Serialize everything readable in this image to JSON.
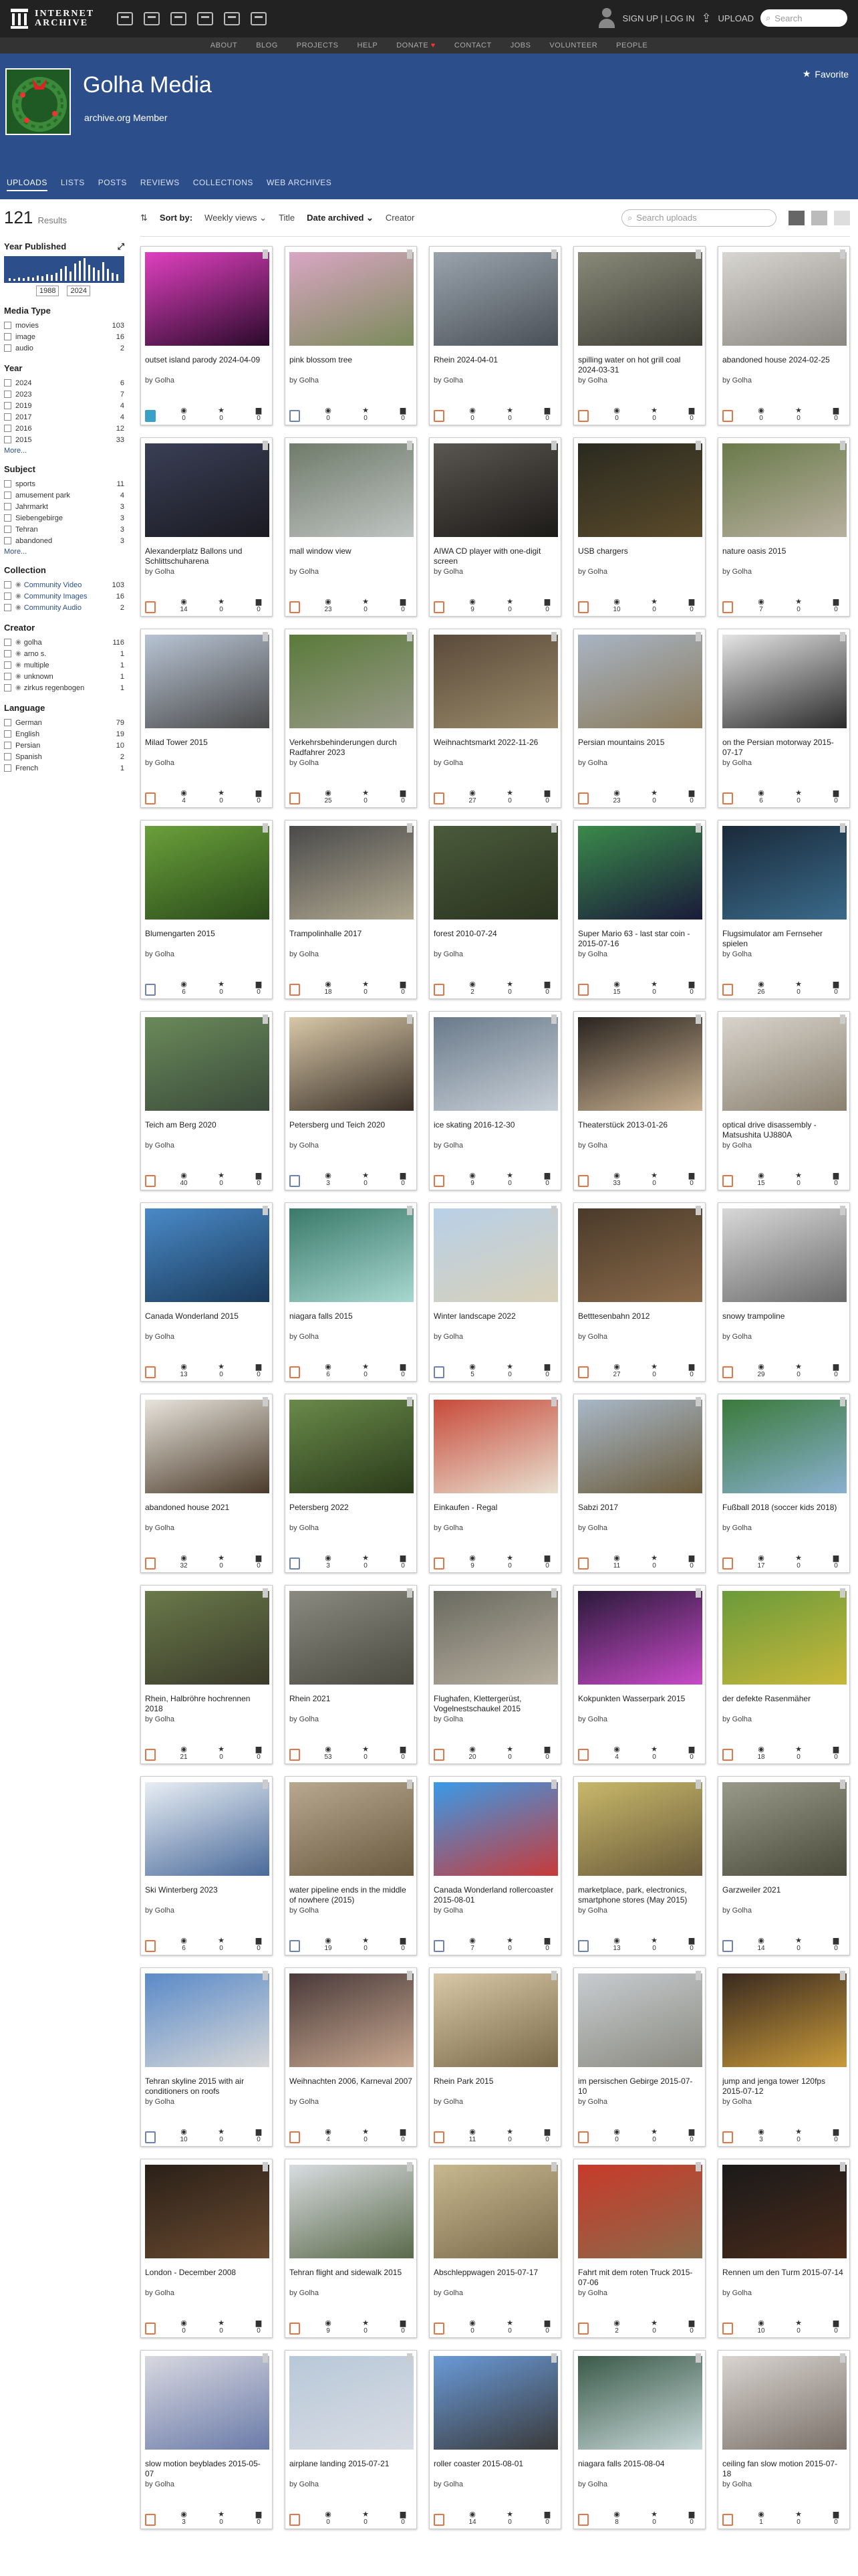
{
  "topbar": {
    "logo_line1": "INTERNET",
    "logo_line2": "ARCHIVE",
    "auth": "SIGN UP | LOG IN",
    "upload": "UPLOAD",
    "search_placeholder": "Search"
  },
  "subnav": [
    "ABOUT",
    "BLOG",
    "PROJECTS",
    "HELP",
    "DONATE",
    "CONTACT",
    "JOBS",
    "VOLUNTEER",
    "PEOPLE"
  ],
  "profile": {
    "name": "Golha Media",
    "subtitle": "archive.org Member",
    "favorite": "Favorite",
    "tabs": [
      "UPLOADS",
      "LISTS",
      "POSTS",
      "REVIEWS",
      "COLLECTIONS",
      "WEB ARCHIVES"
    ]
  },
  "results": {
    "count": "121",
    "label": "Results"
  },
  "sidebar": {
    "year_published": "Year Published",
    "year_from": "1988",
    "year_to": "2024",
    "media_type": {
      "title": "Media Type",
      "items": [
        {
          "label": "movies",
          "n": "103"
        },
        {
          "label": "image",
          "n": "16"
        },
        {
          "label": "audio",
          "n": "2"
        }
      ]
    },
    "year": {
      "title": "Year",
      "items": [
        {
          "label": "2024",
          "n": "6"
        },
        {
          "label": "2023",
          "n": "7"
        },
        {
          "label": "2019",
          "n": "4"
        },
        {
          "label": "2017",
          "n": "4"
        },
        {
          "label": "2016",
          "n": "12"
        },
        {
          "label": "2015",
          "n": "33"
        }
      ],
      "more": "More..."
    },
    "subject": {
      "title": "Subject",
      "items": [
        {
          "label": "sports",
          "n": "11"
        },
        {
          "label": "amusement park",
          "n": "4"
        },
        {
          "label": "Jahrmarkt",
          "n": "3"
        },
        {
          "label": "Siebengebirge",
          "n": "3"
        },
        {
          "label": "Tehran",
          "n": "3"
        },
        {
          "label": "abandoned",
          "n": "3"
        }
      ],
      "more": "More..."
    },
    "collection": {
      "title": "Collection",
      "items": [
        {
          "label": "Community Video",
          "n": "103"
        },
        {
          "label": "Community Images",
          "n": "16"
        },
        {
          "label": "Community Audio",
          "n": "2"
        }
      ]
    },
    "creator": {
      "title": "Creator",
      "items": [
        {
          "label": "golha",
          "n": "116"
        },
        {
          "label": "arno s.",
          "n": "1"
        },
        {
          "label": "multiple",
          "n": "1"
        },
        {
          "label": "unknown",
          "n": "1"
        },
        {
          "label": "zirkus regenbogen",
          "n": "1"
        }
      ]
    },
    "language": {
      "title": "Language",
      "items": [
        {
          "label": "German",
          "n": "79"
        },
        {
          "label": "English",
          "n": "19"
        },
        {
          "label": "Persian",
          "n": "10"
        },
        {
          "label": "Spanish",
          "n": "2"
        },
        {
          "label": "French",
          "n": "1"
        }
      ]
    }
  },
  "sortbar": {
    "sort_by": "Sort by:",
    "views": "Weekly views",
    "title": "Title",
    "date": "Date archived",
    "creator": "Creator",
    "search_placeholder": "Search uploads"
  },
  "cards": [
    {
      "title": "outset island parody 2024-04-09",
      "by": "by Golha",
      "type": "audio",
      "views": "0",
      "favs": "0",
      "reviews": "0",
      "c1": "#e040c0",
      "c2": "#2a0a2a"
    },
    {
      "title": "pink blossom tree",
      "by": "by Golha",
      "type": "image",
      "views": "0",
      "favs": "0",
      "reviews": "0",
      "c1": "#d9a6c3",
      "c2": "#7a8a5a"
    },
    {
      "title": "Rhein 2024-04-01",
      "by": "by Golha",
      "type": "movies",
      "views": "0",
      "favs": "0",
      "reviews": "0",
      "c1": "#9aa4ad",
      "c2": "#4a5058"
    },
    {
      "title": "spilling water on hot grill coal 2024-03-31",
      "by": "by Golha",
      "type": "movies",
      "views": "0",
      "favs": "0",
      "reviews": "0",
      "c1": "#8a8a7a",
      "c2": "#3c3c34"
    },
    {
      "title": "abandoned house 2024-02-25",
      "by": "by Golha",
      "type": "movies",
      "views": "0",
      "favs": "0",
      "reviews": "0",
      "c1": "#d8d6d2",
      "c2": "#8a8680"
    },
    {
      "title": "Alexanderplatz Ballons und Schlittschuharena",
      "by": "by Golha",
      "type": "movies",
      "views": "14",
      "favs": "0",
      "reviews": "0",
      "c1": "#3a3f55",
      "c2": "#1a1a22"
    },
    {
      "title": "mall window view",
      "by": "by Golha",
      "type": "movies",
      "views": "23",
      "favs": "0",
      "reviews": "0",
      "c1": "#6f7b6a",
      "c2": "#bfc4c2"
    },
    {
      "title": "AIWA CD player with one-digit screen",
      "by": "by Golha",
      "type": "movies",
      "views": "9",
      "favs": "0",
      "reviews": "0",
      "c1": "#5a5650",
      "c2": "#1c1a18"
    },
    {
      "title": "USB chargers",
      "by": "by Golha",
      "type": "movies",
      "views": "10",
      "favs": "0",
      "reviews": "0",
      "c1": "#2a2a20",
      "c2": "#5a4a2a"
    },
    {
      "title": "nature oasis 2015",
      "by": "by Golha",
      "type": "movies",
      "views": "7",
      "favs": "0",
      "reviews": "0",
      "c1": "#6a7a4a",
      "c2": "#b8b0a0"
    },
    {
      "title": "Milad Tower 2015",
      "by": "by Golha",
      "type": "movies",
      "views": "4",
      "favs": "0",
      "reviews": "0",
      "c1": "#b8c4d4",
      "c2": "#4a4a4a"
    },
    {
      "title": "Verkehrsbehinderungen durch Radfahrer 2023",
      "by": "by Golha",
      "type": "movies",
      "views": "25",
      "favs": "0",
      "reviews": "0",
      "c1": "#5a7a3a",
      "c2": "#9a9a8a"
    },
    {
      "title": "Weihnachtsmarkt 2022-11-26",
      "by": "by Golha",
      "type": "movies",
      "views": "27",
      "favs": "0",
      "reviews": "0",
      "c1": "#5a4a3a",
      "c2": "#9a8a6a"
    },
    {
      "title": "Persian mountains 2015",
      "by": "by Golha",
      "type": "movies",
      "views": "23",
      "favs": "0",
      "reviews": "0",
      "c1": "#a8b4c4",
      "c2": "#8a7a5a"
    },
    {
      "title": "on the Persian motorway 2015-07-17",
      "by": "by Golha",
      "type": "movies",
      "views": "6",
      "favs": "0",
      "reviews": "0",
      "c1": "#e4e4e4",
      "c2": "#2a2a2a"
    },
    {
      "title": "Blumengarten 2015",
      "by": "by Golha",
      "type": "image",
      "views": "6",
      "favs": "0",
      "reviews": "0",
      "c1": "#6aa03a",
      "c2": "#2a4a1a"
    },
    {
      "title": "Trampolinhalle 2017",
      "by": "by Golha",
      "type": "movies",
      "views": "18",
      "favs": "0",
      "reviews": "0",
      "c1": "#4a4a4a",
      "c2": "#b0a890"
    },
    {
      "title": "forest 2010-07-24",
      "by": "by Golha",
      "type": "movies",
      "views": "2",
      "favs": "0",
      "reviews": "0",
      "c1": "#4a5a3a",
      "c2": "#2a3320"
    },
    {
      "title": "Super Mario 63 - last star coin - 2015-07-16",
      "by": "by Golha",
      "type": "movies",
      "views": "15",
      "favs": "0",
      "reviews": "0",
      "c1": "#3a8a4a",
      "c2": "#1a1a3a"
    },
    {
      "title": "Flugsimulator am Fernseher spielen",
      "by": "by Golha",
      "type": "movies",
      "views": "26",
      "favs": "0",
      "reviews": "0",
      "c1": "#1a2a3a",
      "c2": "#3a6a8a"
    },
    {
      "title": "Teich am Berg 2020",
      "by": "by Golha",
      "type": "movies",
      "views": "40",
      "favs": "0",
      "reviews": "0",
      "c1": "#6a8a5a",
      "c2": "#3a4a3a"
    },
    {
      "title": "Petersberg und Teich 2020",
      "by": "by Golha",
      "type": "image",
      "views": "3",
      "favs": "0",
      "reviews": "0",
      "c1": "#d8c8a8",
      "c2": "#3a3028"
    },
    {
      "title": "ice skating 2016-12-30",
      "by": "by Golha",
      "type": "movies",
      "views": "9",
      "favs": "0",
      "reviews": "0",
      "c1": "#6a7a8a",
      "c2": "#c8d0d8"
    },
    {
      "title": "Theaterstück 2013-01-26",
      "by": "by Golha",
      "type": "movies",
      "views": "33",
      "favs": "0",
      "reviews": "0",
      "c1": "#2a2420",
      "c2": "#c8b090"
    },
    {
      "title": "optical drive disassembly - Matsushita UJ880A",
      "by": "by Golha",
      "type": "movies",
      "views": "15",
      "favs": "0",
      "reviews": "0",
      "c1": "#d8d4cc",
      "c2": "#8a8070"
    },
    {
      "title": "Canada Wonderland 2015",
      "by": "by Golha",
      "type": "movies",
      "views": "13",
      "favs": "0",
      "reviews": "0",
      "c1": "#4a8ac8",
      "c2": "#1a3a5a"
    },
    {
      "title": "niagara falls 2015",
      "by": "by Golha",
      "type": "movies",
      "views": "6",
      "favs": "0",
      "reviews": "0",
      "c1": "#3a7a6a",
      "c2": "#a8d8d0"
    },
    {
      "title": "Winter landscape 2022",
      "by": "by Golha",
      "type": "image",
      "views": "5",
      "favs": "0",
      "reviews": "0",
      "c1": "#b8d0e8",
      "c2": "#d8d0b8"
    },
    {
      "title": "Betttesenbahn 2012",
      "by": "by Golha",
      "type": "movies",
      "views": "27",
      "favs": "0",
      "reviews": "0",
      "c1": "#4a3a2a",
      "c2": "#8a6a4a"
    },
    {
      "title": "snowy trampoline",
      "by": "by Golha",
      "type": "movies",
      "views": "29",
      "favs": "0",
      "reviews": "0",
      "c1": "#d8d8d8",
      "c2": "#6a6a6a"
    },
    {
      "title": "abandoned house 2021",
      "by": "by Golha",
      "type": "movies",
      "views": "32",
      "favs": "0",
      "reviews": "0",
      "c1": "#e8e4dc",
      "c2": "#4a3a2a"
    },
    {
      "title": "Petersberg 2022",
      "by": "by Golha",
      "type": "image",
      "views": "3",
      "favs": "0",
      "reviews": "0",
      "c1": "#6a8a4a",
      "c2": "#2a3a1a"
    },
    {
      "title": "Einkaufen - Regal",
      "by": "by Golha",
      "type": "movies",
      "views": "9",
      "favs": "0",
      "reviews": "0",
      "c1": "#c84a3a",
      "c2": "#e8e0d0"
    },
    {
      "title": "Sabzi 2017",
      "by": "by Golha",
      "type": "movies",
      "views": "11",
      "favs": "0",
      "reviews": "0",
      "c1": "#a8b8c8",
      "c2": "#6a5a3a"
    },
    {
      "title": "Fußball 2018 (soccer kids 2018)",
      "by": "by Golha",
      "type": "movies",
      "views": "17",
      "favs": "0",
      "reviews": "0",
      "c1": "#3a7a3a",
      "c2": "#8ab0d0"
    },
    {
      "title": "Rhein, Halbröhre hochrennen 2018",
      "by": "by Golha",
      "type": "movies",
      "views": "21",
      "favs": "0",
      "reviews": "0",
      "c1": "#6a7a4a",
      "c2": "#3a3a2a"
    },
    {
      "title": "Rhein 2021",
      "by": "by Golha",
      "type": "movies",
      "views": "53",
      "favs": "0",
      "reviews": "0",
      "c1": "#8a8a80",
      "c2": "#4a4a40"
    },
    {
      "title": "Flughafen, Klettergerüst, Vogelnestschaukel 2015",
      "by": "by Golha",
      "type": "movies",
      "views": "20",
      "favs": "0",
      "reviews": "0",
      "c1": "#6a6a60",
      "c2": "#b8b0a0"
    },
    {
      "title": "Kokpunkten Wasserpark 2015",
      "by": "by Golha",
      "type": "movies",
      "views": "4",
      "favs": "0",
      "reviews": "0",
      "c1": "#2a1a3a",
      "c2": "#c84ac8"
    },
    {
      "title": "der defekte Rasenmäher",
      "by": "by Golha",
      "type": "movies",
      "views": "18",
      "favs": "0",
      "reviews": "0",
      "c1": "#6a9a3a",
      "c2": "#c8b83a"
    },
    {
      "title": "Ski Winterberg 2023",
      "by": "by Golha",
      "type": "movies",
      "views": "6",
      "favs": "0",
      "reviews": "0",
      "c1": "#e8eef4",
      "c2": "#4a6a9a"
    },
    {
      "title": "water pipeline ends in the middle of nowhere (2015)",
      "by": "by Golha",
      "type": "image",
      "views": "19",
      "favs": "0",
      "reviews": "0",
      "c1": "#b8a890",
      "c2": "#6a5a40"
    },
    {
      "title": "Canada Wonderland rollercoaster 2015-08-01",
      "by": "by Golha",
      "type": "image",
      "views": "7",
      "favs": "0",
      "reviews": "0",
      "c1": "#3a9ae8",
      "c2": "#c83a3a"
    },
    {
      "title": "marketplace, park, electronics, smartphone stores (May 2015)",
      "by": "by Golha",
      "type": "image",
      "views": "13",
      "favs": "0",
      "reviews": "0",
      "c1": "#c8b86a",
      "c2": "#6a5a3a"
    },
    {
      "title": "Garzweiler 2021",
      "by": "by Golha",
      "type": "image",
      "views": "14",
      "favs": "0",
      "reviews": "0",
      "c1": "#9a9a8a",
      "c2": "#4a4a3a"
    },
    {
      "title": "Tehran skyline 2015 with air conditioners on roofs",
      "by": "by Golha",
      "type": "image",
      "views": "10",
      "favs": "0",
      "reviews": "0",
      "c1": "#5a8ac8",
      "c2": "#d8d8d8"
    },
    {
      "title": "Weihnachten 2006, Karneval 2007",
      "by": "by Golha",
      "type": "movies",
      "views": "4",
      "favs": "0",
      "reviews": "0",
      "c1": "#4a3a3a",
      "c2": "#c8a890"
    },
    {
      "title": "Rhein Park 2015",
      "by": "by Golha",
      "type": "movies",
      "views": "11",
      "favs": "0",
      "reviews": "0",
      "c1": "#d8c8a8",
      "c2": "#7a6a4a"
    },
    {
      "title": "im persischen Gebirge 2015-07-10",
      "by": "by Golha",
      "type": "movies",
      "views": "0",
      "favs": "0",
      "reviews": "0",
      "c1": "#c8ccd0",
      "c2": "#8a8a80"
    },
    {
      "title": "jump and jenga tower 120fps 2015-07-12",
      "by": "by Golha",
      "type": "movies",
      "views": "3",
      "favs": "0",
      "reviews": "0",
      "c1": "#3a2a20",
      "c2": "#c89a3a"
    },
    {
      "title": "London - December 2008",
      "by": "by Golha",
      "type": "movies",
      "views": "0",
      "favs": "0",
      "reviews": "0",
      "c1": "#2a2018",
      "c2": "#6a4a30"
    },
    {
      "title": "Tehran flight and sidewalk 2015",
      "by": "by Golha",
      "type": "movies",
      "views": "9",
      "favs": "0",
      "reviews": "0",
      "c1": "#d8dce0",
      "c2": "#5a6a4a"
    },
    {
      "title": "Abschleppwagen 2015-07-17",
      "by": "by Golha",
      "type": "movies",
      "views": "0",
      "favs": "0",
      "reviews": "0",
      "c1": "#c8b890",
      "c2": "#7a6a4a"
    },
    {
      "title": "Fahrt mit dem roten Truck 2015-07-06",
      "by": "by Golha",
      "type": "movies",
      "views": "2",
      "favs": "0",
      "reviews": "0",
      "c1": "#c83a2a",
      "c2": "#8a6a4a"
    },
    {
      "title": "Rennen um den Turm 2015-07-14",
      "by": "by Golha",
      "type": "movies",
      "views": "10",
      "favs": "0",
      "reviews": "0",
      "c1": "#1a1a1a",
      "c2": "#4a2a1a"
    },
    {
      "title": "slow motion beyblades 2015-05-07",
      "by": "by Golha",
      "type": "movies",
      "views": "3",
      "favs": "0",
      "reviews": "0",
      "c1": "#d8d8e0",
      "c2": "#6a7aa8"
    },
    {
      "title": "airplane landing 2015-07-21",
      "by": "by Golha",
      "type": "movies",
      "views": "0",
      "favs": "0",
      "reviews": "0",
      "c1": "#b8c8d8",
      "c2": "#d8dce4"
    },
    {
      "title": "roller coaster 2015-08-01",
      "by": "by Golha",
      "type": "movies",
      "views": "14",
      "favs": "0",
      "reviews": "0",
      "c1": "#6a9ad8",
      "c2": "#3a3a3a"
    },
    {
      "title": "niagara falls 2015-08-04",
      "by": "by Golha",
      "type": "movies",
      "views": "8",
      "favs": "0",
      "reviews": "0",
      "c1": "#3a5a4a",
      "c2": "#c8d8d8"
    },
    {
      "title": "ceiling fan slow motion 2015-07-18",
      "by": "by Golha",
      "type": "movies",
      "views": "1",
      "favs": "0",
      "reviews": "0",
      "c1": "#d8d4d0",
      "c2": "#7a7068"
    }
  ]
}
